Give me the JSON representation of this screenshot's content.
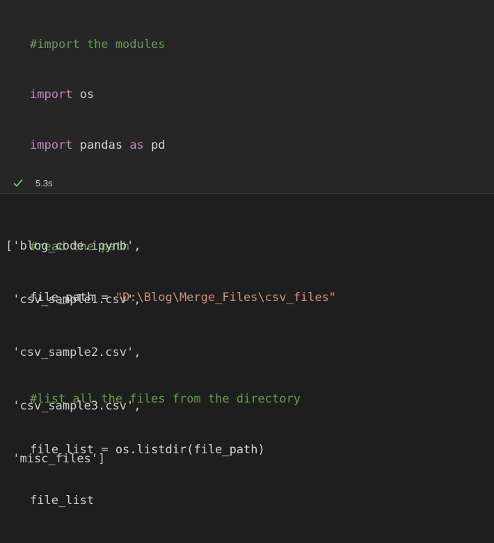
{
  "code_cell": {
    "lines": [
      {
        "comment": "#import the modules"
      },
      {
        "kw": "import",
        "rest": " os"
      },
      {
        "kw": "import",
        "rest": " pandas ",
        "kw2": "as",
        "rest2": " pd"
      },
      {
        "blank": ""
      },
      {
        "comment": "#read the path"
      },
      {
        "pre": "file_path = ",
        "str": "\"D:\\Blog\\Merge_Files\\csv_files\""
      },
      {
        "blank": ""
      },
      {
        "comment": "#list all the files from the directory"
      },
      {
        "plain": "file_list = os.listdir(file_path)"
      },
      {
        "plain": "file_list"
      }
    ]
  },
  "status": {
    "icon": "check-icon",
    "icon_color": "#89d185",
    "duration": "5.3s"
  },
  "output": {
    "lines": [
      "['blog_code.ipynb',",
      " 'csv_sample1.csv',",
      " 'csv_sample2.csv',",
      " 'csv_sample3.csv',",
      " 'misc_files']"
    ]
  },
  "colors": {
    "cell_background": "#262626",
    "output_background": "#1e1e1e",
    "comment": "#6a9955",
    "keyword": "#c586c0",
    "string": "#ce9178",
    "text": "#d4d4d4"
  }
}
